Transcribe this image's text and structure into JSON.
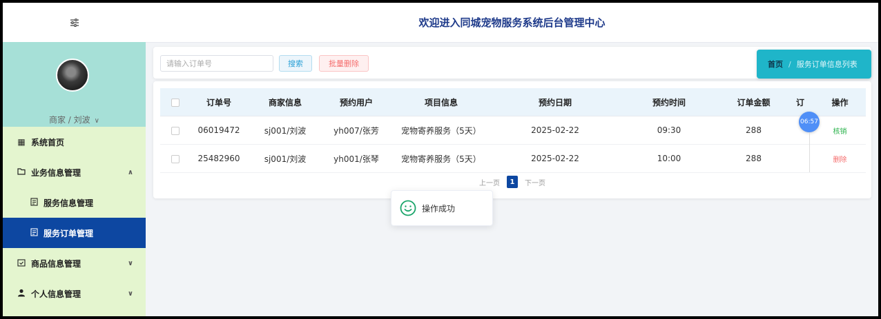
{
  "header": {
    "title": "欢迎进入同城宠物服务系统后台管理中心",
    "menu_icon": "sliders-icon"
  },
  "profile": {
    "user_label": "商家 / 刘波"
  },
  "sidebar": {
    "items": [
      {
        "label": "系统首页",
        "icon": "grid-icon"
      },
      {
        "label": "业务信息管理",
        "icon": "folder-icon",
        "expanded": true
      },
      {
        "label": "服务信息管理",
        "icon": "document-icon"
      },
      {
        "label": "服务订单管理",
        "icon": "document-icon",
        "active": true
      },
      {
        "label": "商品信息管理",
        "icon": "calendar-check-icon"
      },
      {
        "label": "个人信息管理",
        "icon": "user-icon"
      }
    ]
  },
  "toolbar": {
    "search_placeholder": "请输入订单号",
    "search_label": "搜索",
    "batch_delete_label": "批量删除"
  },
  "breadcrumb": {
    "home": "首页",
    "separator": "/",
    "current": "服务订单信息列表"
  },
  "table": {
    "columns": [
      "订单号",
      "商家信息",
      "预约用户",
      "项目信息",
      "预约日期",
      "预约时间",
      "订单金额",
      "订",
      "操作"
    ],
    "rows": [
      {
        "order_no": "06019472",
        "merchant": "sj001/刘波",
        "user": "yh007/张芳",
        "item": "宠物寄养服务（5天）",
        "date": "2025-02-22",
        "time": "09:30",
        "amount": "288",
        "action": "核销"
      },
      {
        "order_no": "25482960",
        "merchant": "sj001/刘波",
        "user": "yh001/张琴",
        "item": "宠物寄养服务（5天）",
        "date": "2025-02-22",
        "time": "10:00",
        "amount": "288",
        "action": "删除"
      }
    ]
  },
  "pagination": {
    "prev": "上一页",
    "current": "1",
    "next": "下一页"
  },
  "overlay": {
    "time": "06:57"
  },
  "toast": {
    "message": "操作成功"
  },
  "colors": {
    "sidebar_active": "#0d47a1",
    "breadcrumb_bg": "#1fb5c9",
    "sidebar_bg": "#e4f5cf",
    "profile_bg": "#a6e0d7"
  }
}
